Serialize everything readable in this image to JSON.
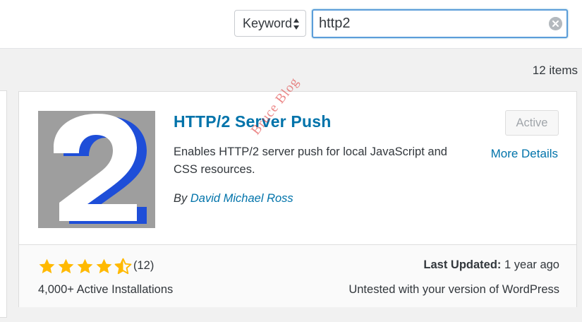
{
  "search": {
    "type_select": "Keyword",
    "query": "http2"
  },
  "results": {
    "count_text": "12 items"
  },
  "plugin": {
    "name": "HTTP/2 Server Push",
    "description": "Enables HTTP/2 server push for local JavaScript and CSS resources.",
    "author_prefix": "By",
    "author_name": "David Michael Ross",
    "status_button": "Active",
    "more_details": "More Details",
    "rating": {
      "stars": 4.5,
      "max_stars": 5,
      "count_text": "(12)"
    },
    "installs": "4,000+ Active Installations",
    "last_updated_label": "Last Updated:",
    "last_updated_value": "1 year ago",
    "compatibility": "Untested with your version of WordPress",
    "icon": {
      "name": "http2-number-2-icon",
      "glyph": "2",
      "bg_color": "#9e9e9e",
      "fg_color": "#ffffff",
      "shadow_color": "#1e4ed8"
    }
  },
  "watermark": "Bruce Blog",
  "colors": {
    "link": "#0073aa",
    "star": "#ffb900",
    "focus": "#5b9dd9"
  }
}
